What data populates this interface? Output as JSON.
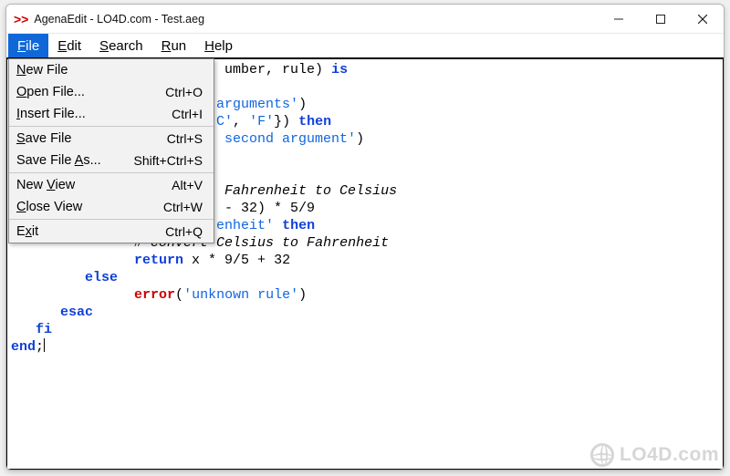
{
  "window": {
    "icon_text": ">>",
    "title": "AgenaEdit - LO4D.com - Test.aeg"
  },
  "menubar": {
    "items": [
      {
        "label": "File",
        "underline_index": 0,
        "active": true
      },
      {
        "label": "Edit",
        "underline_index": 0,
        "active": false
      },
      {
        "label": "Search",
        "underline_index": 0,
        "active": false
      },
      {
        "label": "Run",
        "underline_index": 0,
        "active": false
      },
      {
        "label": "Help",
        "underline_index": 0,
        "active": false
      }
    ]
  },
  "file_menu": {
    "items": [
      {
        "label": "New File",
        "underline_index": 0,
        "shortcut": ""
      },
      {
        "label": "Open File...",
        "underline_index": 0,
        "shortcut": "Ctrl+O"
      },
      {
        "label": "Insert File...",
        "underline_index": 0,
        "shortcut": "Ctrl+I"
      },
      {
        "sep": true
      },
      {
        "label": "Save File",
        "underline_index": 0,
        "shortcut": "Ctrl+S"
      },
      {
        "label": "Save File As...",
        "underline_index": 10,
        "shortcut": "Shift+Ctrl+S"
      },
      {
        "sep": true
      },
      {
        "label": "New View",
        "underline_index": 4,
        "shortcut": "Alt+V"
      },
      {
        "label": "Close View",
        "underline_index": 0,
        "shortcut": "Ctrl+W"
      },
      {
        "sep": true
      },
      {
        "label": "Exit",
        "underline_index": 1,
        "shortcut": "Ctrl+Q"
      }
    ]
  },
  "code": [
    {
      "indent": 0,
      "parts": [
        {
          "t": "                          umber, rule) ",
          "c": ""
        },
        {
          "t": "is",
          "c": "kw"
        }
      ]
    },
    {
      "indent": 0,
      "parts": []
    },
    {
      "indent": 0,
      "parts": [
        {
          "t": "                         arguments'",
          "c": "str"
        },
        {
          "t": ")",
          "c": ""
        }
      ]
    },
    {
      "indent": 0,
      "parts": [
        {
          "t": "                         C'",
          "c": "str"
        },
        {
          "t": ", ",
          "c": ""
        },
        {
          "t": "'F'",
          "c": "str"
        },
        {
          "t": "}) ",
          "c": ""
        },
        {
          "t": "then",
          "c": "kw"
        }
      ]
    },
    {
      "indent": 0,
      "parts": [
        {
          "t": "                          second argument'",
          "c": "str"
        },
        {
          "t": ")",
          "c": ""
        }
      ]
    },
    {
      "indent": 0,
      "parts": []
    },
    {
      "indent": 0,
      "parts": []
    },
    {
      "indent": 0,
      "parts": [
        {
          "t": "                          Fahrenheit to Celsius",
          "c": "com"
        }
      ]
    },
    {
      "indent": 0,
      "parts": [
        {
          "t": "                          - 32) * 5/9",
          "c": ""
        }
      ]
    },
    {
      "indent": 0,
      "parts": [
        {
          "t": "                         enheit'",
          "c": "str"
        },
        {
          "t": " ",
          "c": ""
        },
        {
          "t": "then",
          "c": "kw"
        }
      ]
    },
    {
      "indent": 0,
      "parts": [
        {
          "t": "               ",
          "c": ""
        },
        {
          "t": "# convert Celsius to Fahrenheit",
          "c": "com"
        }
      ]
    },
    {
      "indent": 0,
      "parts": [
        {
          "t": "               ",
          "c": ""
        },
        {
          "t": "return",
          "c": "kw"
        },
        {
          "t": " x * 9/5 + 32",
          "c": ""
        }
      ]
    },
    {
      "indent": 0,
      "parts": [
        {
          "t": "         ",
          "c": ""
        },
        {
          "t": "else",
          "c": "kw"
        }
      ]
    },
    {
      "indent": 0,
      "parts": [
        {
          "t": "               ",
          "c": ""
        },
        {
          "t": "error",
          "c": "fn"
        },
        {
          "t": "(",
          "c": ""
        },
        {
          "t": "'unknown rule'",
          "c": "str"
        },
        {
          "t": ")",
          "c": ""
        }
      ]
    },
    {
      "indent": 0,
      "parts": [
        {
          "t": "      ",
          "c": ""
        },
        {
          "t": "esac",
          "c": "kw"
        }
      ]
    },
    {
      "indent": 0,
      "parts": [
        {
          "t": "   ",
          "c": ""
        },
        {
          "t": "fi",
          "c": "kw"
        }
      ]
    },
    {
      "indent": 0,
      "parts": [
        {
          "t": "end",
          "c": "kw"
        },
        {
          "t": ";",
          "c": ""
        },
        {
          "t": "|",
          "c": "cursor"
        }
      ]
    }
  ],
  "watermark": {
    "text": "LO4D.com"
  }
}
